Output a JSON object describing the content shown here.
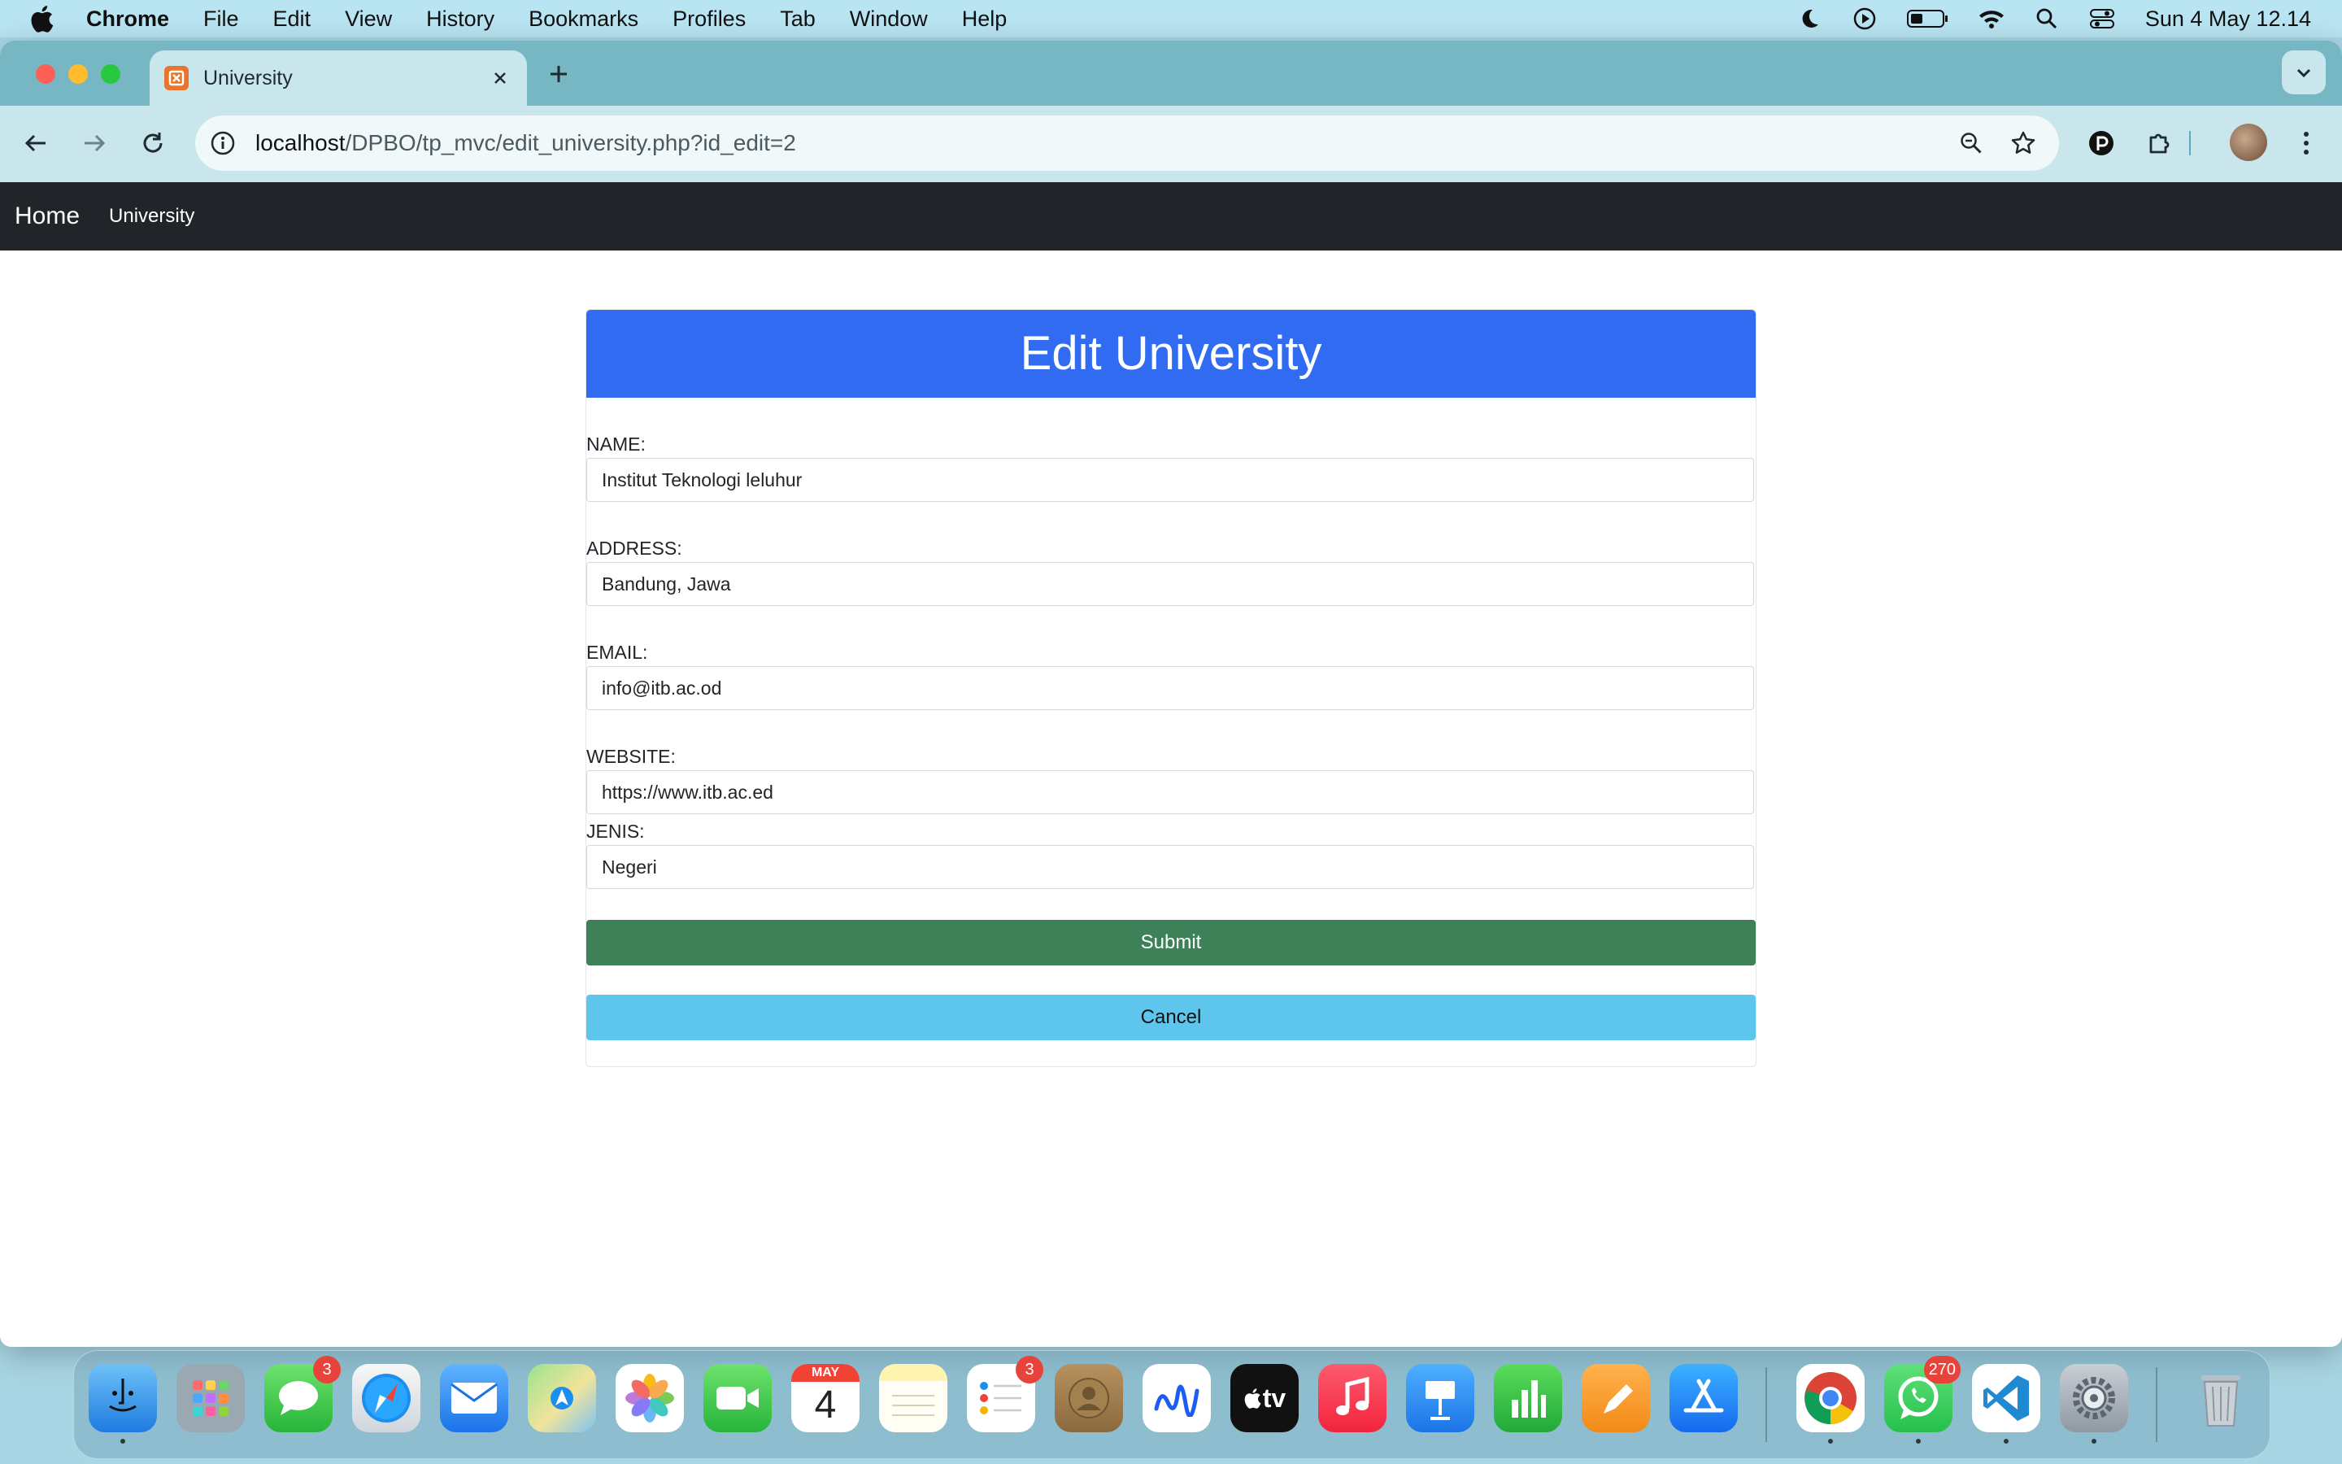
{
  "menubar": {
    "app_name": "Chrome",
    "items": [
      "File",
      "Edit",
      "View",
      "History",
      "Bookmarks",
      "Profiles",
      "Tab",
      "Window",
      "Help"
    ],
    "clock": "Sun 4 May  12.14",
    "status_icons": [
      "moon-icon",
      "play-circle-icon",
      "battery-icon",
      "wifi-icon",
      "spotlight-search-icon",
      "control-center-icon"
    ]
  },
  "browser": {
    "tab_title": "University",
    "url_host": "localhost",
    "url_path": "/DPBO/tp_mvc/edit_university.php?id_edit=2"
  },
  "navbar": {
    "brand": "Home",
    "link": "University"
  },
  "form": {
    "title": "Edit University",
    "name_label": "NAME:",
    "name_value": "Institut Teknologi leluhur",
    "address_label": "ADDRESS:",
    "address_value": "Bandung, Jawa",
    "email_label": "EMAIL:",
    "email_value": "info@itb.ac.od",
    "website_label": "WEBSITE:",
    "website_value": "https://www.itb.ac.ed",
    "jenis_label": "JENIS:",
    "jenis_value": "Negeri",
    "submit_label": "Submit",
    "cancel_label": "Cancel"
  },
  "dock": {
    "calendar_month": "MAY",
    "calendar_day": "4",
    "messages_badge": "3",
    "reminders_badge": "3",
    "whatsapp_badge": "270",
    "tv_label": "tv"
  },
  "colors": {
    "navbar_bg": "#212529",
    "card_header_bg": "#306bf1",
    "submit_bg": "#3e8159",
    "cancel_bg": "#5ec6ec"
  }
}
